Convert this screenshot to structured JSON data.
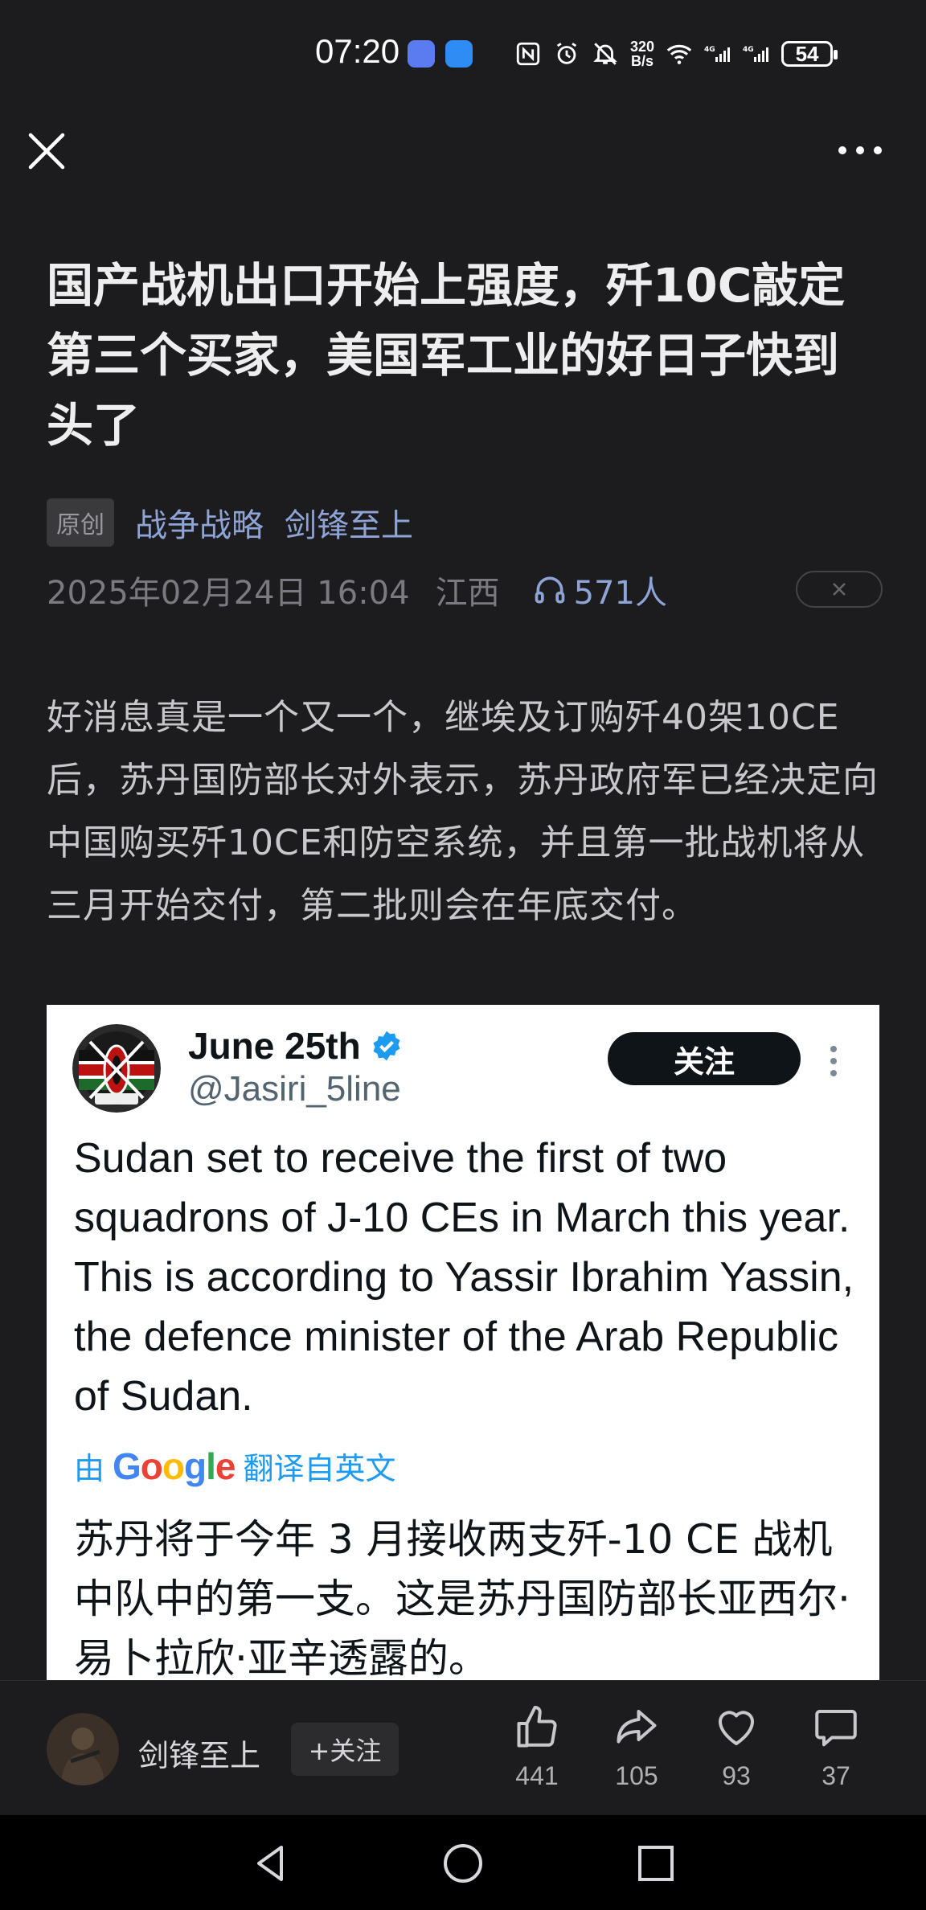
{
  "status_bar": {
    "time": "07:20",
    "net_speed_value": "320",
    "net_speed_unit": "B/s",
    "signal1_label": "4G",
    "signal2_label": "4G",
    "battery": "54"
  },
  "article": {
    "title": "国产战机出口开始上强度，歼10C敲定第三个买家，美国军工业的好日子快到头了",
    "badge": "原创",
    "category": "战争战略",
    "author_tag": "剑锋至上",
    "date": "2025年02月24日 16:04",
    "location": "江西",
    "listeners": "571人",
    "body": "好消息真是一个又一个，继埃及订购歼40架10CE后，苏丹国防部长对外表示，苏丹政府军已经决定向中国购买歼10CE和防空系统，并且第一批战机将从三月开始交付，第二批则会在年底交付。"
  },
  "tweet": {
    "name": "June 25th",
    "handle": "@Jasiri_5line",
    "follow_label": "关注",
    "text": "Sudan set to receive the first of two squadrons of J-10 CEs in March this year. This is according to Yassir Ibrahim Yassin, the defence minister of the Arab Republic of Sudan.",
    "translated_prefix": "由",
    "translated_suffix": "翻译自英文",
    "google_letters": [
      "G",
      "o",
      "o",
      "g",
      "l",
      "e"
    ],
    "translation": "苏丹将于今年 3 月接收两支歼-10 CE 战机中队中的第一支。这是苏丹国防部长亚西尔·易卜拉欣·亚辛透露的。"
  },
  "action_bar": {
    "author_name": "剑锋至上",
    "follow_label": "+关注",
    "likes": "441",
    "shares": "105",
    "favorites": "93",
    "comments": "37"
  },
  "colors": {
    "background": "#1c1c1e",
    "link": "#8fa4d6",
    "twitter_blue": "#1d9bf0"
  }
}
